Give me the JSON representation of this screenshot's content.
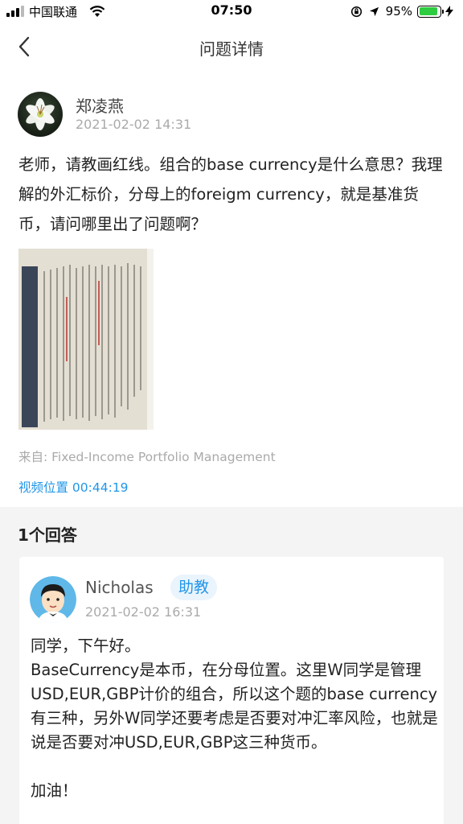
{
  "status_bar": {
    "carrier": "中国联通",
    "time": "07:50",
    "battery": "95%",
    "battery_level": 0.95,
    "battery_color": "#2ecc40"
  },
  "nav": {
    "title": "问题详情",
    "back_icon": "chevron-left-icon"
  },
  "question": {
    "author": "郑凌燕",
    "time": "2021-02-02 14:31",
    "body": "老师，请教画红线。组合的base currency是什么意思？我理解的外汇标价，分母上的foreigm currency，就是基准货币，请问哪里出了问题啊？",
    "source": "来自: Fixed-Income Portfolio Management",
    "video_position": "视频位置 00:44:19"
  },
  "answers": {
    "count_label": "1个回答",
    "items": [
      {
        "author": "Nicholas",
        "badge": "助教",
        "time": "2021-02-02 16:31",
        "paragraphs": [
          "同学，下午好。",
          "BaseCurrency是本币，在分母位置。这里W同学是管理USD,EUR,GBP计价的组合，所以这个题的base currency有三种，另外W同学还要考虑是否要对冲汇率风险，也就是说是否要对冲USD,EUR,GBP这三种货币。",
          "加油！"
        ]
      }
    ]
  },
  "colors": {
    "accent": "#2196e8",
    "muted": "#aaaaaa",
    "section_bg": "#f4f4f4"
  }
}
